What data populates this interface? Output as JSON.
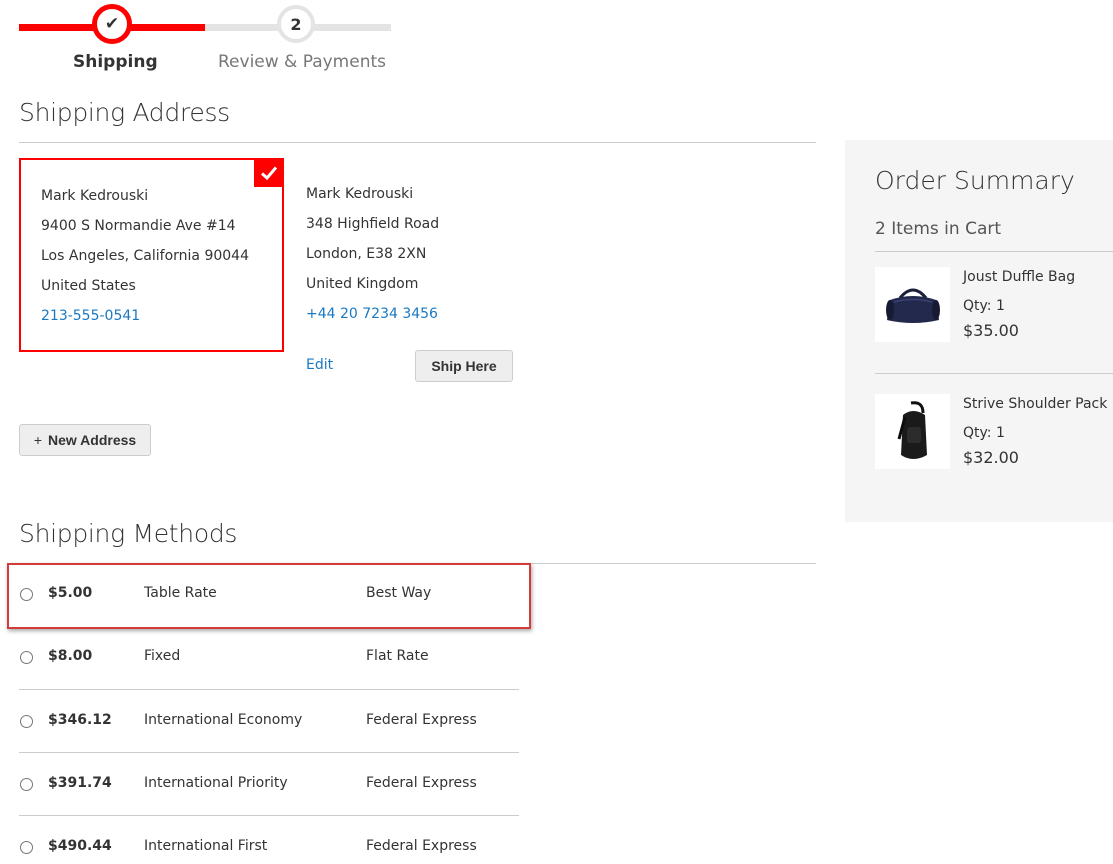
{
  "progress": {
    "steps": [
      {
        "number": "✔",
        "label": "Shipping"
      },
      {
        "number": "2",
        "label": "Review & Payments"
      }
    ]
  },
  "shipping_address": {
    "title": "Shipping Address",
    "selected": {
      "name": "Mark Kedrouski",
      "street": "9400 S Normandie Ave #14",
      "city_line": "Los Angeles, California 90044",
      "country": "United States",
      "phone": "213-555-0541"
    },
    "other": {
      "name": "Mark Kedrouski",
      "street": "348 Highfield Road",
      "city_line": "London, E38 2XN",
      "country": "United Kingdom",
      "phone": "+44 20 7234 3456"
    },
    "edit_label": "Edit",
    "ship_here_label": "Ship Here",
    "new_address_plus": "+",
    "new_address_label": "New Address"
  },
  "shipping_methods": {
    "title": "Shipping Methods",
    "rows": [
      {
        "price": "$5.00",
        "method": "Table Rate",
        "carrier": "Best Way"
      },
      {
        "price": "$8.00",
        "method": "Fixed",
        "carrier": "Flat Rate"
      },
      {
        "price": "$346.12",
        "method": "International Economy",
        "carrier": "Federal Express"
      },
      {
        "price": "$391.74",
        "method": "International Priority",
        "carrier": "Federal Express"
      },
      {
        "price": "$490.44",
        "method": "International First",
        "carrier": "Federal Express"
      }
    ]
  },
  "order_summary": {
    "title": "Order Summary",
    "items_count": "2 Items in Cart",
    "items": [
      {
        "name": "Joust Duffle Bag",
        "qty": "Qty: 1",
        "price": "$35.00"
      },
      {
        "name": "Strive Shoulder Pack",
        "qty": "Qty: 1",
        "price": "$32.00"
      }
    ]
  },
  "colors": {
    "accent": "#ff0000",
    "link": "#1979c3",
    "summary_bg": "#f5f5f5"
  }
}
